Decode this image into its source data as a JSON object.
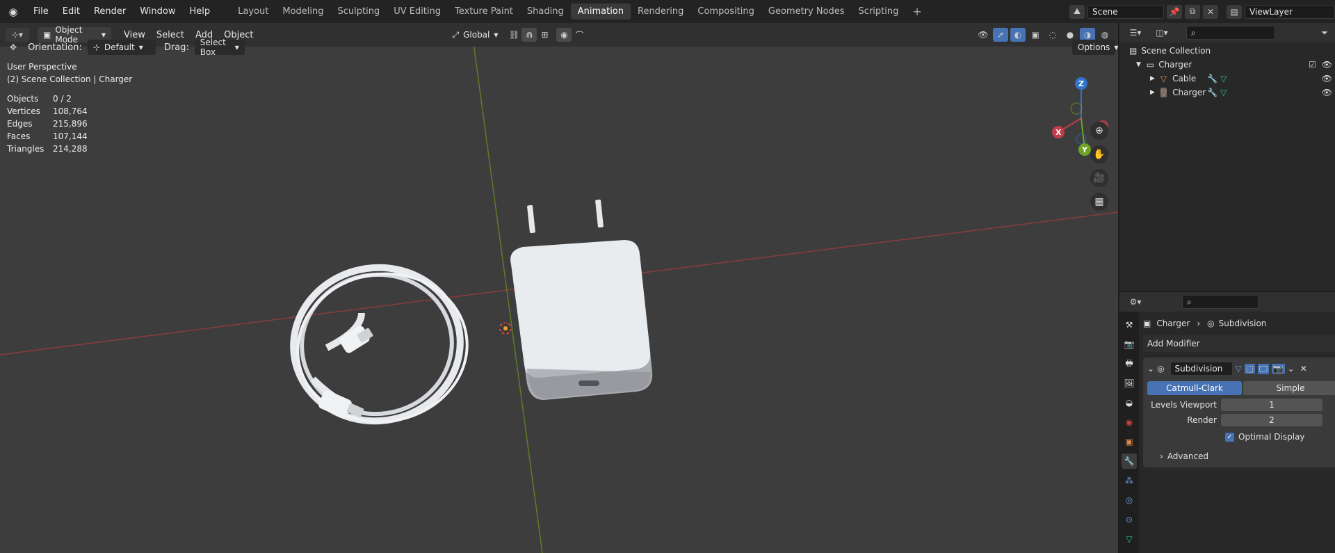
{
  "topbar": {
    "menu": [
      "File",
      "Edit",
      "Render",
      "Window",
      "Help"
    ],
    "workspaces": [
      "Layout",
      "Modeling",
      "Sculpting",
      "UV Editing",
      "Texture Paint",
      "Shading",
      "Animation",
      "Rendering",
      "Compositing",
      "Geometry Nodes",
      "Scripting"
    ],
    "active_workspace": "Animation",
    "scene": "Scene",
    "view_layer": "ViewLayer"
  },
  "header": {
    "mode": "Object Mode",
    "menus": [
      "View",
      "Select",
      "Add",
      "Object"
    ],
    "transform": "Global",
    "options": "Options"
  },
  "tool_options": {
    "orientation_label": "Orientation:",
    "orientation_value": "Default",
    "drag_label": "Drag:",
    "drag_value": "Select Box"
  },
  "viewport": {
    "view_name": "User Perspective",
    "collection": "(2) Scene Collection | Charger",
    "stats": [
      {
        "label": "Objects",
        "value": "0 / 2"
      },
      {
        "label": "Vertices",
        "value": "108,764"
      },
      {
        "label": "Edges",
        "value": "215,896"
      },
      {
        "label": "Faces",
        "value": "107,144"
      },
      {
        "label": "Triangles",
        "value": "214,288"
      }
    ],
    "gizmo": {
      "x": "X",
      "y": "Y",
      "z": "Z"
    }
  },
  "outliner": {
    "root": "Scene Collection",
    "collection": "Charger",
    "items": [
      "Cable",
      "Charger"
    ]
  },
  "properties": {
    "breadcrumb_obj": "Charger",
    "breadcrumb_mod": "Subdivision",
    "add_modifier": "Add Modifier",
    "modifier_name": "Subdivision",
    "method_a": "Catmull-Clark",
    "method_b": "Simple",
    "levels_viewport_label": "Levels Viewport",
    "levels_viewport_value": "1",
    "render_label": "Render",
    "render_value": "2",
    "optimal_display": "Optimal Display",
    "advanced": "Advanced"
  }
}
